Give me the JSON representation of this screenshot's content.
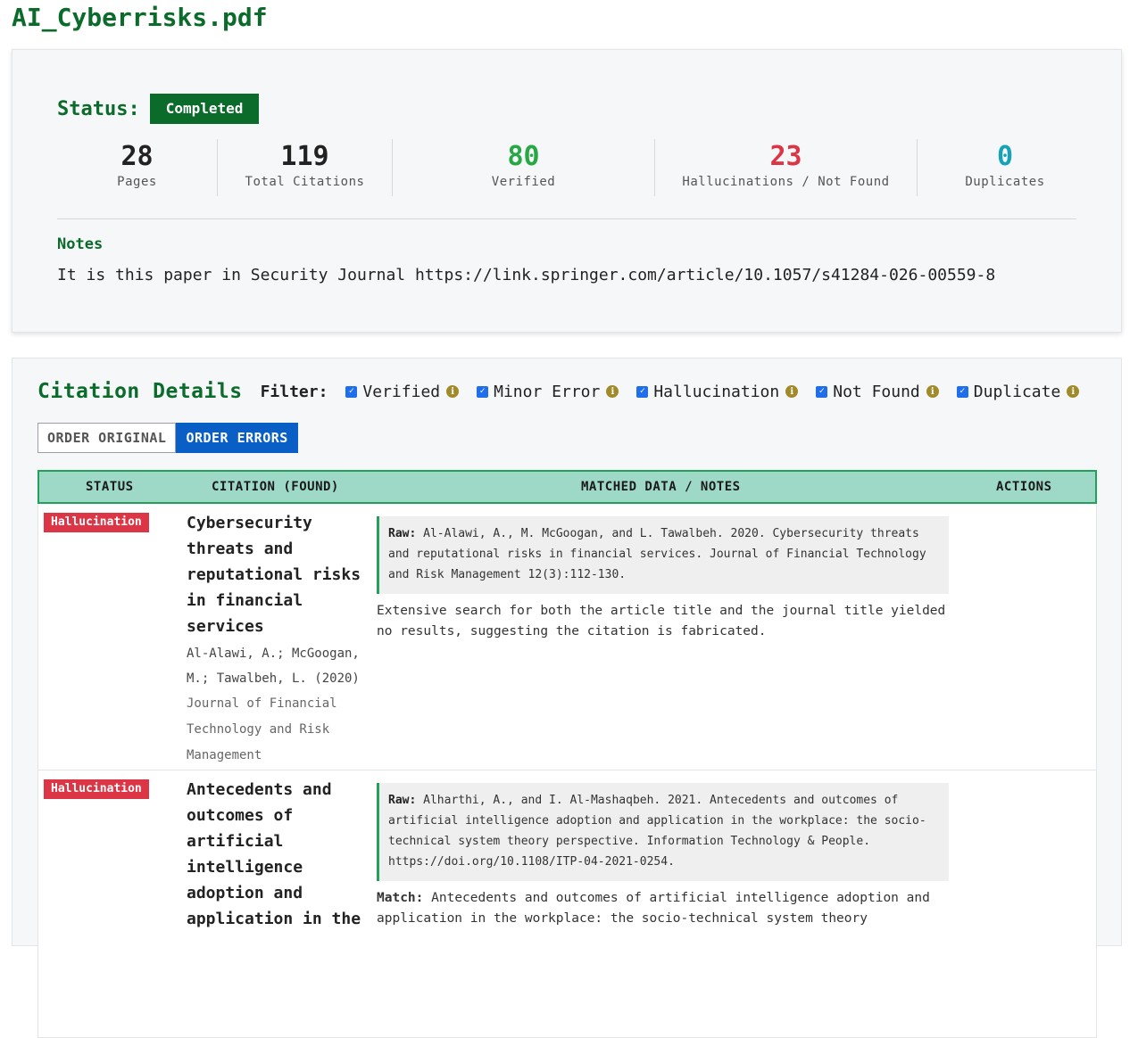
{
  "file_name": "AI_Cyberrisks.pdf",
  "status": {
    "label": "Status:",
    "value": "Completed"
  },
  "stats": [
    {
      "value": "28",
      "label": "Pages",
      "color": "#222222"
    },
    {
      "value": "119",
      "label": "Total Citations",
      "color": "#222222"
    },
    {
      "value": "80",
      "label": "Verified",
      "color": "#28a745"
    },
    {
      "value": "23",
      "label": "Hallucinations / Not Found",
      "color": "#dc3545"
    },
    {
      "value": "0",
      "label": "Duplicates",
      "color": "#17a2b8"
    }
  ],
  "notes": {
    "label": "Notes",
    "text": "It is this paper in Security Journal https://link.springer.com/article/10.1057/s41284-026-00559-8"
  },
  "details": {
    "title": "Citation Details",
    "filter_label": "Filter:",
    "filters": [
      {
        "label": "Verified",
        "checked": true
      },
      {
        "label": "Minor Error",
        "checked": true
      },
      {
        "label": "Hallucination",
        "checked": true
      },
      {
        "label": "Not Found",
        "checked": true
      },
      {
        "label": "Duplicate",
        "checked": true
      }
    ],
    "order_original": "ORDER ORIGINAL",
    "order_errors": "ORDER ERRORS"
  },
  "table": {
    "headers": [
      "STATUS",
      "CITATION (FOUND)",
      "MATCHED DATA / NOTES",
      "ACTIONS"
    ],
    "rows": [
      {
        "status": "Hallucination",
        "title": "Cybersecurity threats and reputational risks in financial services",
        "authors": "Al-Alawi, A.; McGoogan, M.; Tawalbeh, L. (2020)",
        "journal": "Journal of Financial Technology and Risk Management",
        "raw_label": "Raw:",
        "raw": "Al-Alawi, A., M. McGoogan, and L. Tawalbeh. 2020. Cybersecurity threats and reputational risks in financial services. Journal of Financial Technology and Risk Management 12(3):112-130.",
        "note": "Extensive search for both the article title and the journal title yielded no results, suggesting the citation is fabricated."
      },
      {
        "status": "Hallucination",
        "title": "Antecedents and outcomes of artificial intelligence adoption and application in the",
        "raw_label": "Raw:",
        "raw": "Alharthi, A., and I. Al-Mashaqbeh. 2021. Antecedents and outcomes of artificial intelligence adoption and application in the workplace: the socio-technical system theory perspective. Information Technology & People. https://doi.org/10.1108/ITP-04-2021-0254.",
        "match_label": "Match:",
        "match": "Antecedents and outcomes of artificial intelligence adoption and application in the workplace: the socio-technical system theory"
      }
    ]
  }
}
